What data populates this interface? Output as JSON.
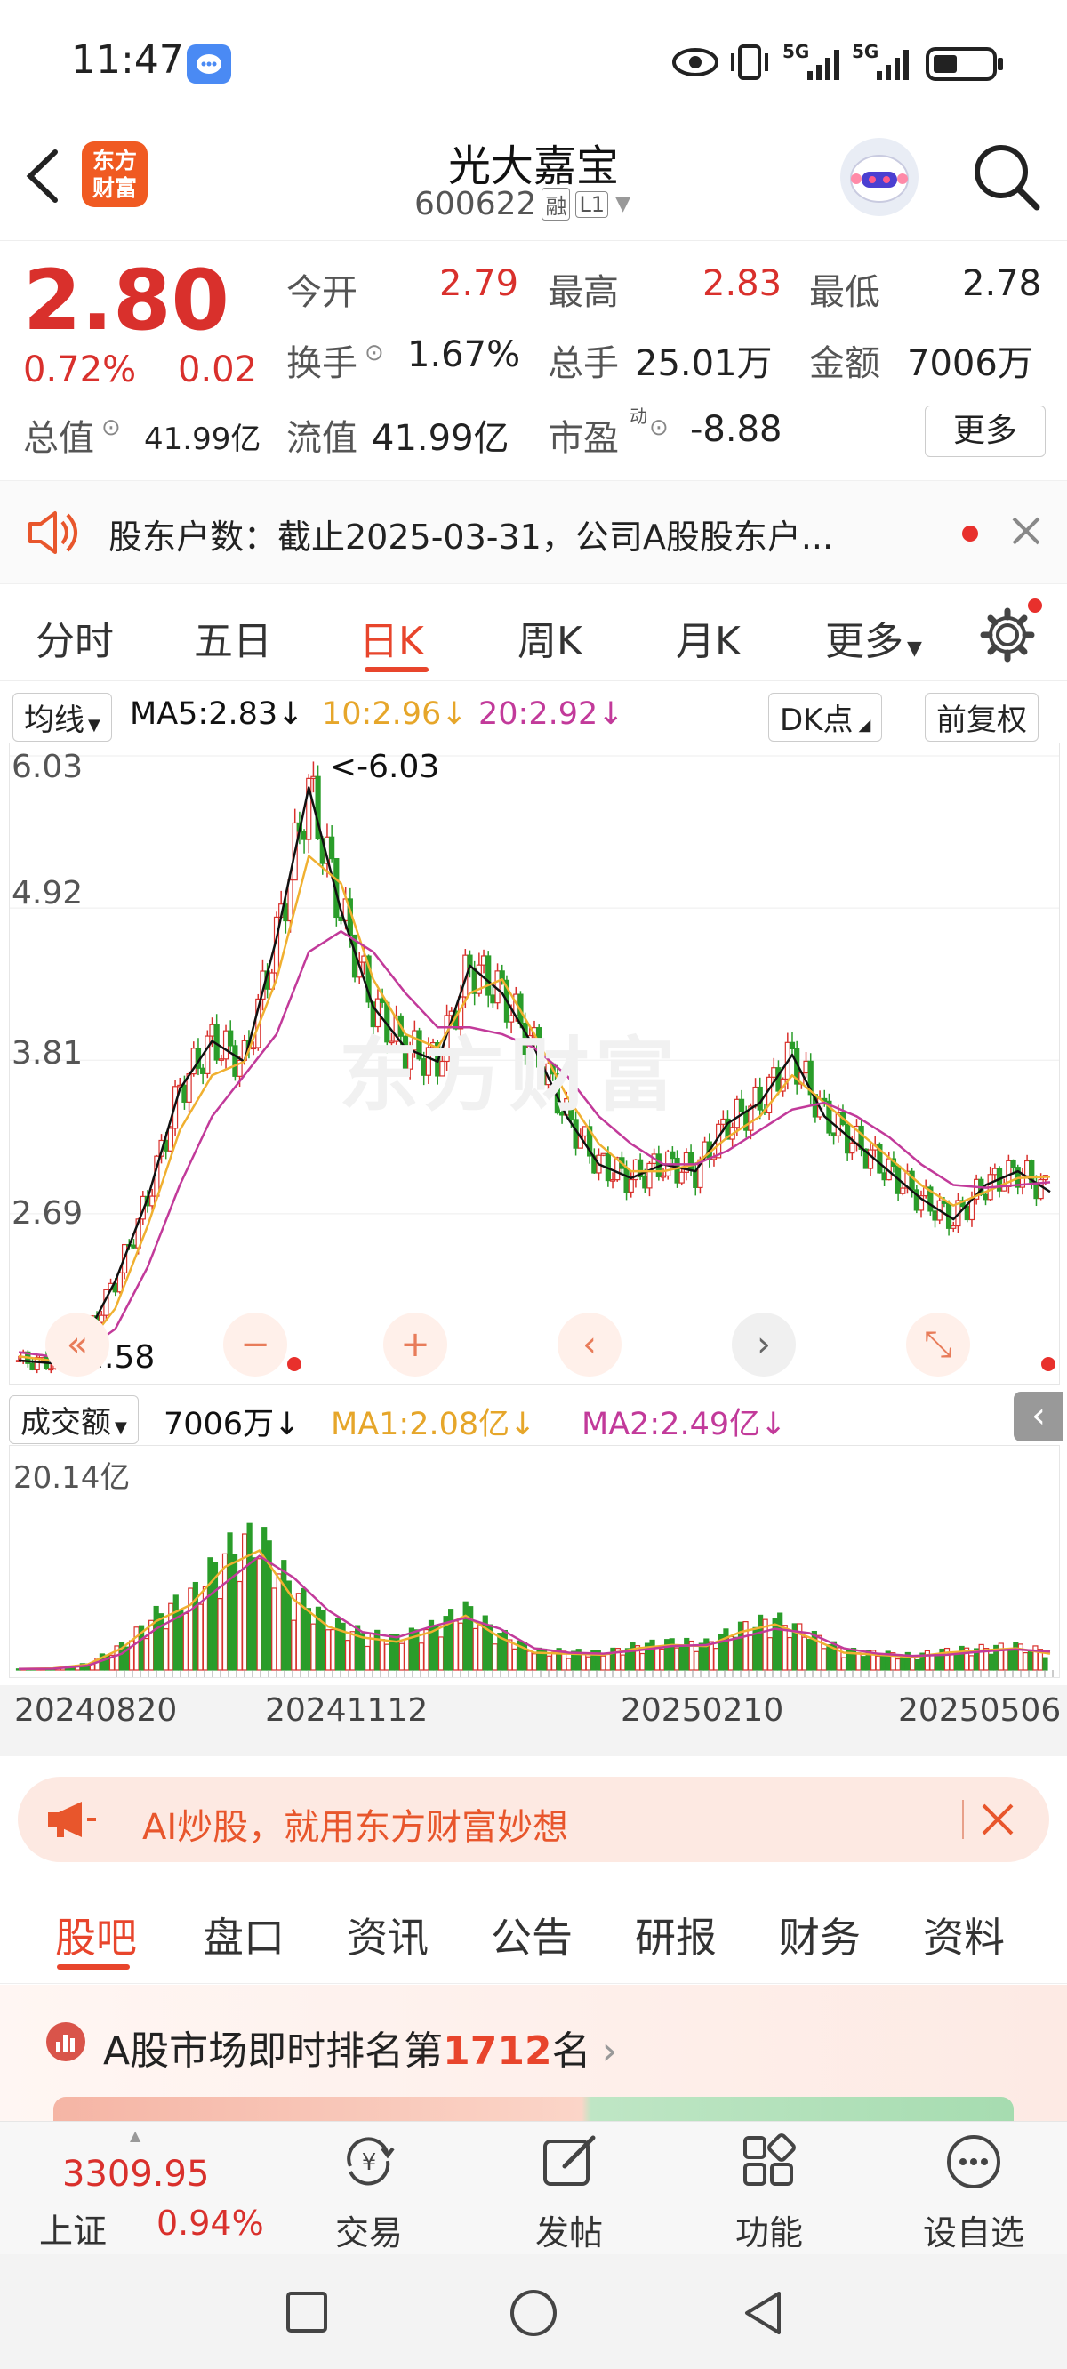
{
  "status_bar": {
    "time": "11:47",
    "network_1": "5G",
    "network_2": "5G"
  },
  "header": {
    "logo_line1": "东方",
    "logo_line2": "财富",
    "stock_name": "光大嘉宝",
    "stock_code": "600622",
    "tag_margin": "融",
    "tag_level": "L1"
  },
  "quote": {
    "price": "2.80",
    "change_pct": "0.72%",
    "change_amt": "0.02",
    "open_label": "今开",
    "open": "2.79",
    "high_label": "最高",
    "high": "2.83",
    "low_label": "最低",
    "low": "2.78",
    "turnover_label": "换手",
    "turnover": "1.67%",
    "volume_label": "总手",
    "volume": "25.01万",
    "amount_label": "金额",
    "amount": "7006万",
    "mktcap_label": "总值",
    "mktcap": "41.99亿",
    "float_label": "流值",
    "float_cap": "41.99亿",
    "pe_label": "市盈",
    "pe_sup": "动",
    "pe": "-8.88",
    "more_button": "更多"
  },
  "notice": {
    "text": "股东户数：截止2025-03-31，公司A股股东户..."
  },
  "chart_tabs": [
    "分时",
    "五日",
    "日K",
    "周K",
    "月K",
    "更多"
  ],
  "chart_tabs_active": 2,
  "kline": {
    "ma_selector": "均线",
    "ma5": "MA5:2.83",
    "ma10": "10:2.96",
    "ma20": "20:2.92",
    "dk_button": "DK点",
    "adjust_button": "前复权",
    "watermark": "东方财富",
    "max_label": "<-6.03",
    "min_label": "<-1.58",
    "colors": {
      "up": "#d9302c",
      "down": "#2a9d2a",
      "ma5": "#111111",
      "ma10": "#f0b030",
      "ma20": "#c23a9a"
    }
  },
  "chart_data": [
    {
      "type": "candlestick",
      "title": "",
      "y_ticks": [
        "6.03",
        "4.92",
        "3.81",
        "2.69"
      ],
      "ylim": [
        1.58,
        6.03
      ],
      "x_ticks": [
        "20240820",
        "20241112",
        "20250210",
        "20250506"
      ],
      "series": [
        {
          "name": "MA5",
          "values": [
            1.62,
            1.6,
            1.75,
            2.2,
            2.8,
            3.6,
            3.95,
            3.8,
            4.7,
            5.8,
            4.9,
            4.2,
            3.9,
            3.8,
            4.5,
            4.3,
            3.9,
            3.4,
            3.05,
            2.95,
            3.05,
            3.0,
            3.35,
            3.5,
            3.85,
            3.4,
            3.2,
            3.0,
            2.8,
            2.65,
            2.9,
            3.0,
            2.85
          ]
        },
        {
          "name": "MA10",
          "values": [
            1.65,
            1.62,
            1.7,
            2.0,
            2.6,
            3.3,
            3.7,
            3.8,
            4.4,
            5.3,
            5.1,
            4.4,
            4.0,
            3.9,
            4.3,
            4.4,
            4.0,
            3.55,
            3.2,
            3.0,
            3.0,
            3.05,
            3.25,
            3.4,
            3.7,
            3.5,
            3.3,
            3.1,
            2.9,
            2.75,
            2.85,
            2.95,
            2.96
          ]
        },
        {
          "name": "MA20",
          "values": [
            1.68,
            1.65,
            1.68,
            1.85,
            2.3,
            2.9,
            3.4,
            3.7,
            4.0,
            4.6,
            4.75,
            4.6,
            4.3,
            4.05,
            4.05,
            4.0,
            3.9,
            3.7,
            3.4,
            3.2,
            3.05,
            3.05,
            3.15,
            3.3,
            3.45,
            3.5,
            3.4,
            3.25,
            3.05,
            2.9,
            2.88,
            2.9,
            2.92
          ]
        }
      ]
    },
    {
      "type": "bar",
      "title": "成交额",
      "ylabel_top": "20.14亿",
      "series": [
        {
          "name": "MA1",
          "values": [
            0.1,
            0.15,
            0.5,
            2.0,
            4.5,
            6.0,
            9.5,
            11.0,
            6.5,
            4.0,
            3.0,
            2.6,
            3.5,
            5.0,
            3.0,
            1.6,
            1.5,
            1.4,
            2.0,
            2.3,
            2.2,
            3.5,
            4.2,
            3.0,
            1.6,
            1.4,
            1.2,
            1.6,
            1.8,
            2.0,
            1.5
          ]
        },
        {
          "name": "MA2",
          "values": [
            0.1,
            0.12,
            0.4,
            1.5,
            3.8,
            5.5,
            8.0,
            10.5,
            8.5,
            5.5,
            3.5,
            3.0,
            4.0,
            4.8,
            3.8,
            2.0,
            1.6,
            1.5,
            1.8,
            2.2,
            2.3,
            3.0,
            3.8,
            3.4,
            2.0,
            1.5,
            1.3,
            1.4,
            1.7,
            1.9,
            1.7
          ]
        }
      ]
    }
  ],
  "volume": {
    "selector": "成交额",
    "value": "7006万",
    "ma1": "MA1:2.08亿",
    "ma2": "MA2:2.49亿",
    "top_label": "20.14亿"
  },
  "ad_banner": {
    "text": "AI炒股，就用东方财富妙想"
  },
  "content_tabs": [
    "股吧",
    "盘口",
    "资讯",
    "公告",
    "研报",
    "财务",
    "资料"
  ],
  "content_tabs_active": 0,
  "ranking": {
    "prefix": "A股市场即时排名第",
    "rank": "1712",
    "suffix": "名"
  },
  "bottom_bar": {
    "index_value": "3309.95",
    "index_name": "上证",
    "index_change": "0.94%",
    "items": [
      "交易",
      "发帖",
      "功能",
      "设自选"
    ]
  }
}
